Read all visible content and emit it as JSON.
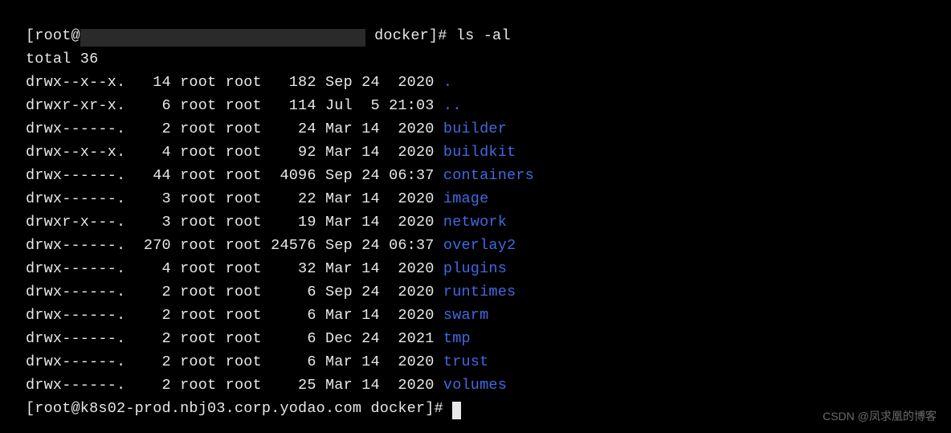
{
  "prompt1": {
    "prefix": "[root@",
    "suffix": " docker]# ",
    "command": "ls -al"
  },
  "total_line": "total 36",
  "rows": [
    {
      "perm": "drwx--x--x.",
      "links": "14",
      "owner": "root",
      "group": "root",
      "size": "182",
      "month": "Sep",
      "day": "24",
      "time": "2020",
      "name": ".",
      "dir": true
    },
    {
      "perm": "drwxr-xr-x.",
      "links": "6",
      "owner": "root",
      "group": "root",
      "size": "114",
      "month": "Jul",
      "day": "5",
      "time": "21:03",
      "name": "..",
      "dir": true
    },
    {
      "perm": "drwx------.",
      "links": "2",
      "owner": "root",
      "group": "root",
      "size": "24",
      "month": "Mar",
      "day": "14",
      "time": "2020",
      "name": "builder",
      "dir": true
    },
    {
      "perm": "drwx--x--x.",
      "links": "4",
      "owner": "root",
      "group": "root",
      "size": "92",
      "month": "Mar",
      "day": "14",
      "time": "2020",
      "name": "buildkit",
      "dir": true
    },
    {
      "perm": "drwx------.",
      "links": "44",
      "owner": "root",
      "group": "root",
      "size": "4096",
      "month": "Sep",
      "day": "24",
      "time": "06:37",
      "name": "containers",
      "dir": true
    },
    {
      "perm": "drwx------.",
      "links": "3",
      "owner": "root",
      "group": "root",
      "size": "22",
      "month": "Mar",
      "day": "14",
      "time": "2020",
      "name": "image",
      "dir": true
    },
    {
      "perm": "drwxr-x---.",
      "links": "3",
      "owner": "root",
      "group": "root",
      "size": "19",
      "month": "Mar",
      "day": "14",
      "time": "2020",
      "name": "network",
      "dir": true
    },
    {
      "perm": "drwx------.",
      "links": "270",
      "owner": "root",
      "group": "root",
      "size": "24576",
      "month": "Sep",
      "day": "24",
      "time": "06:37",
      "name": "overlay2",
      "dir": true
    },
    {
      "perm": "drwx------.",
      "links": "4",
      "owner": "root",
      "group": "root",
      "size": "32",
      "month": "Mar",
      "day": "14",
      "time": "2020",
      "name": "plugins",
      "dir": true
    },
    {
      "perm": "drwx------.",
      "links": "2",
      "owner": "root",
      "group": "root",
      "size": "6",
      "month": "Sep",
      "day": "24",
      "time": "2020",
      "name": "runtimes",
      "dir": true
    },
    {
      "perm": "drwx------.",
      "links": "2",
      "owner": "root",
      "group": "root",
      "size": "6",
      "month": "Mar",
      "day": "14",
      "time": "2020",
      "name": "swarm",
      "dir": true
    },
    {
      "perm": "drwx------.",
      "links": "2",
      "owner": "root",
      "group": "root",
      "size": "6",
      "month": "Dec",
      "day": "24",
      "time": "2021",
      "name": "tmp",
      "dir": true
    },
    {
      "perm": "drwx------.",
      "links": "2",
      "owner": "root",
      "group": "root",
      "size": "6",
      "month": "Mar",
      "day": "14",
      "time": "2020",
      "name": "trust",
      "dir": true
    },
    {
      "perm": "drwx------.",
      "links": "2",
      "owner": "root",
      "group": "root",
      "size": "25",
      "month": "Mar",
      "day": "14",
      "time": "2020",
      "name": "volumes",
      "dir": true
    }
  ],
  "prompt2": "[root@k8s02-prod.nbj03.corp.yodao.com docker]# ",
  "watermark": "CSDN @凤求凰的博客"
}
